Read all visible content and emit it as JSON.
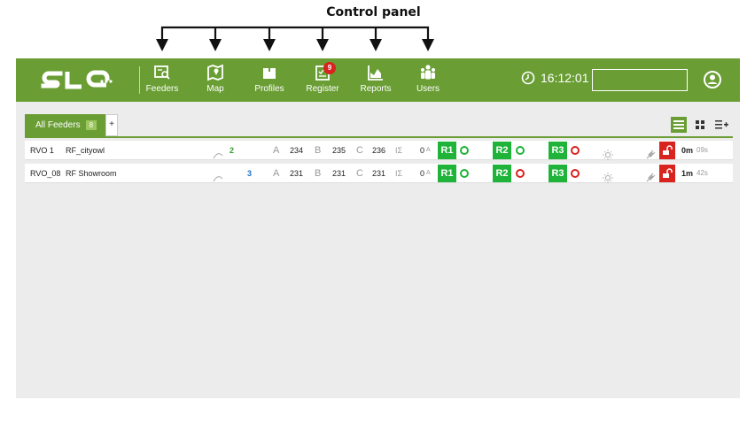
{
  "annotation": {
    "title": "Control panel"
  },
  "header": {
    "logo": "SLE",
    "nav": [
      {
        "label": "Feeders",
        "icon": "feeders-search-icon"
      },
      {
        "label": "Map",
        "icon": "map-icon"
      },
      {
        "label": "Profiles",
        "icon": "profiles-icon"
      },
      {
        "label": "Register",
        "icon": "register-icon",
        "badge": "9"
      },
      {
        "label": "Reports",
        "icon": "reports-chart-icon"
      },
      {
        "label": "Users",
        "icon": "users-group-icon"
      }
    ],
    "time": "16:12:01",
    "search_value": "",
    "user_icon": "user-account-icon"
  },
  "tabs": {
    "active_label": "All Feeders",
    "active_count": "8",
    "add_label": "+"
  },
  "view_buttons": [
    "list-view-icon",
    "grid-view-icon",
    "list-add-icon"
  ],
  "rows": [
    {
      "id": "RVO 1",
      "name": "RF_cityowl",
      "signal": "2",
      "signal_color": "#2ea02e",
      "a_label": "A",
      "a": "234",
      "b_label": "B",
      "b": "235",
      "c_label": "C",
      "c": "236",
      "i_label": "IΣ",
      "i": "0",
      "i_unit": "A",
      "r1": "R1",
      "r1_state": "#1fb33a",
      "r2": "R2",
      "r2_state": "#1fb33a",
      "r3": "R3",
      "r3_state": "#d8231f",
      "time_main": "0m",
      "time_sec": "09s"
    },
    {
      "id": "RVO_08",
      "name": "RF Showroom",
      "signal": "3",
      "signal_color": "#1e6fd0",
      "a_label": "A",
      "a": "231",
      "b_label": "B",
      "b": "231",
      "c_label": "C",
      "c": "231",
      "i_label": "IΣ",
      "i": "0",
      "i_unit": "A",
      "r1": "R1",
      "r1_state": "#1fb33a",
      "r2": "R2",
      "r2_state": "#d8231f",
      "r3": "R3",
      "r3_state": "#d8231f",
      "time_main": "1m",
      "time_sec": "42s"
    }
  ],
  "colors": {
    "brand_green": "#6a9e34",
    "relay_green": "#1fb33a",
    "alarm_red": "#d8231f"
  }
}
